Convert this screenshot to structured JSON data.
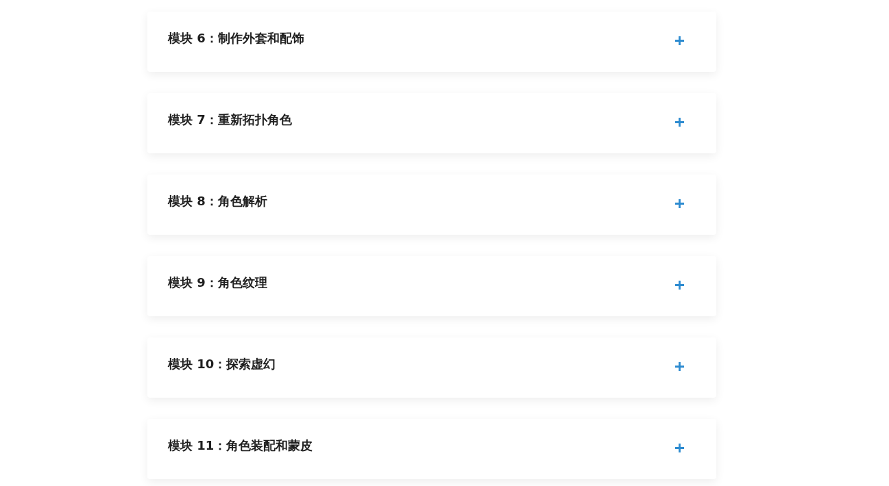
{
  "modules": [
    {
      "title": "模块 6：制作外套和配饰",
      "expanded": false
    },
    {
      "title": "模块 7：重新拓扑角色",
      "expanded": false
    },
    {
      "title": "模块 8：角色解析",
      "expanded": false
    },
    {
      "title": "模块 9：角色纹理",
      "expanded": false
    },
    {
      "title": "模块 10：探索虚幻",
      "expanded": false
    },
    {
      "title": "模块 11：角色装配和蒙皮",
      "expanded": false
    }
  ]
}
